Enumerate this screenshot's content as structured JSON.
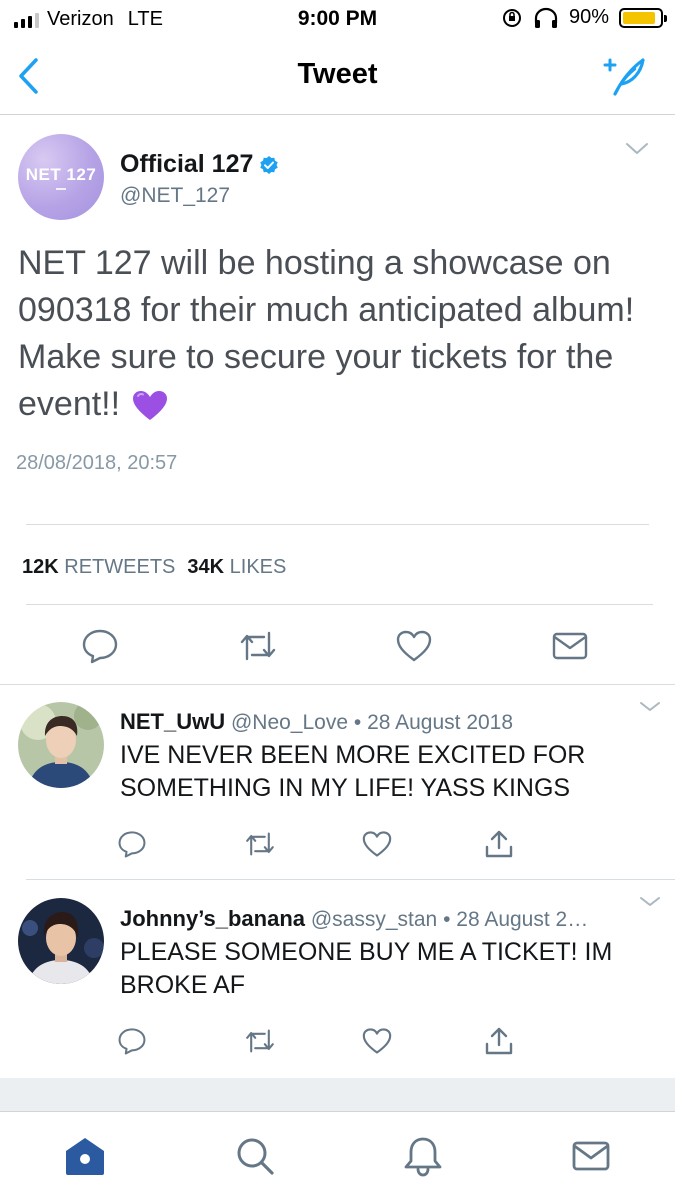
{
  "status_bar": {
    "carrier": "Verizon",
    "network": "LTE",
    "time": "9:00 PM",
    "battery": "90%",
    "battery_level": 0.9,
    "battery_color": "#f5c400"
  },
  "nav": {
    "title": "Tweet",
    "back_icon": "chevron-left-icon",
    "compose_icon": "compose-feather-icon",
    "accent": "#1da1f2"
  },
  "tweet": {
    "avatar_text": "NET 127",
    "author_name": "Official 127",
    "verified": true,
    "handle": "@NET_127",
    "text": "NET 127 will be hosting a showcase on 090318 for their much anticipated album! Make sure to secure your tickets for the event!!",
    "emoji": "purple-heart",
    "timestamp": "28/08/2018, 20:57",
    "retweets_count": "12K",
    "retweets_label": "RETWEETS",
    "likes_count": "34K",
    "likes_label": "LIKES"
  },
  "replies": [
    {
      "name": "NET_UwU",
      "handle": "@Neo_Love",
      "date": "28 August 2018",
      "text": "IVE NEVER BEEN MORE EXCITED FOR SOMETHING IN MY LIFE! YASS KINGS"
    },
    {
      "name": "Johnny’s_banana",
      "handle": "@sassy_stan",
      "date": "28 August 2…",
      "text": "PLEASE SOMEONE BUY ME A TICKET! IM BROKE AF"
    }
  ],
  "separator": "•",
  "tabbar": {
    "items": [
      "home-icon",
      "search-icon",
      "notifications-bell-icon",
      "messages-envelope-icon"
    ],
    "active": "home-icon"
  }
}
